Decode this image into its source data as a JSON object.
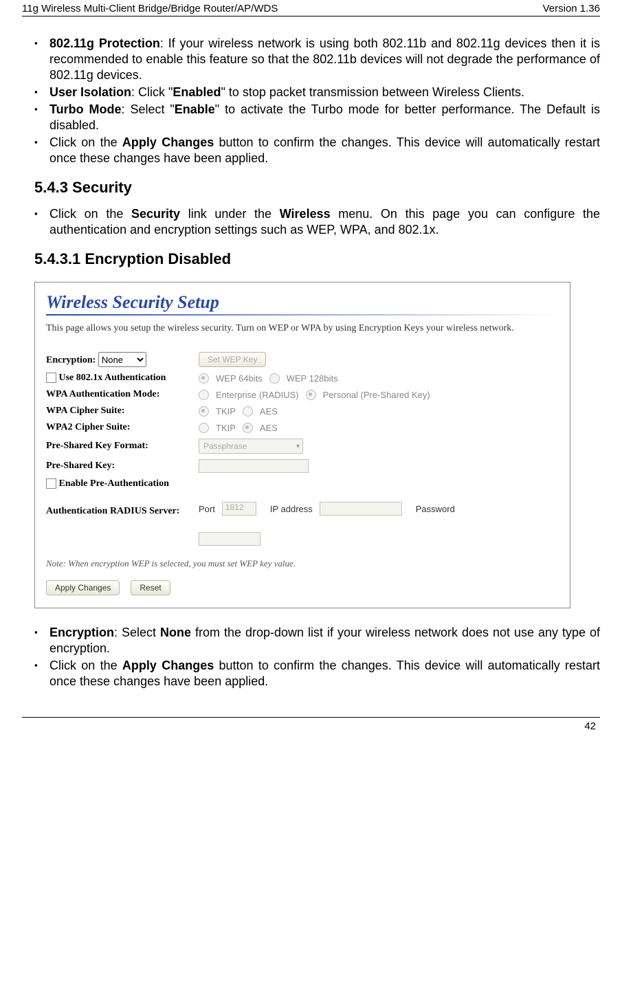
{
  "header": {
    "left": "11g Wireless Multi-Client Bridge/Bridge Router/AP/WDS",
    "right": "Version 1.36"
  },
  "list1": {
    "i0": {
      "b": "802.11g Protection",
      "t": ": If your wireless network is using both 802.11b and 802.11g devices then it is recommended to enable this feature so that the 802.11b devices will not degrade the performance of 802.11g devices."
    },
    "i1": {
      "b": "User Isolation",
      "t1": ": Click \"",
      "bb": "Enabled",
      "t2": "\" to stop packet transmission between Wireless Clients."
    },
    "i2": {
      "b": "Turbo Mode",
      "t1": ": Select \"",
      "bb": "Enable",
      "t2": "\" to activate the Turbo mode for better performance. The Default is disabled."
    },
    "i3": {
      "t1": "Click on the ",
      "bb": "Apply Changes",
      "t2": " button to confirm the changes. This device will automatically restart once these changes have been applied."
    }
  },
  "sec1": "5.4.3  Security",
  "list2": {
    "i0": {
      "t1": "Click on the ",
      "b1": "Security",
      "t2": " link under the ",
      "b2": "Wireless",
      "t3": " menu. On this page you can configure the authentication and encryption settings such as WEP, WPA, and 802.1x."
    }
  },
  "sec2": "5.4.3.1    Encryption Disabled",
  "fig": {
    "title": "Wireless Security Setup",
    "desc": "This page allows you setup the wireless security. Turn on WEP or WPA by using Encryption Keys your wireless network.",
    "enc_label": "Encryption:",
    "enc_value": "None",
    "setwep": "Set WEP Key",
    "use8021x": "Use 802.1x Authentication",
    "wep64": "WEP 64bits",
    "wep128": "WEP 128bits",
    "wpa_mode_l": "WPA Authentication Mode:",
    "ent": "Enterprise (RADIUS)",
    "psk": "Personal (Pre-Shared Key)",
    "wpa_cs_l": "WPA Cipher Suite:",
    "wpa2_cs_l": "WPA2 Cipher Suite:",
    "tkip": "TKIP",
    "aes": "AES",
    "pskf_l": "Pre-Shared Key Format:",
    "pskf_v": "Passphrase",
    "psk_l": "Pre-Shared Key:",
    "preauth": "Enable Pre-Authentication",
    "radius_l": "Authentication RADIUS Server:",
    "port_l": "Port",
    "port_v": "1812",
    "ip_l": "IP address",
    "pw_l": "Password",
    "note": "Note: When encryption WEP is selected, you must set WEP key value.",
    "apply": "Apply Changes",
    "reset": "Reset"
  },
  "list3": {
    "i0": {
      "b": "Encryption",
      "t1": ": Select ",
      "bb": "None",
      "t2": " from the drop-down list if your wireless network does not use any type of encryption."
    },
    "i1": {
      "t1": "Click on the ",
      "bb": "Apply Changes",
      "t2": " button to confirm the changes. This device will automatically restart once these changes have been applied."
    }
  },
  "pagenum": "42"
}
